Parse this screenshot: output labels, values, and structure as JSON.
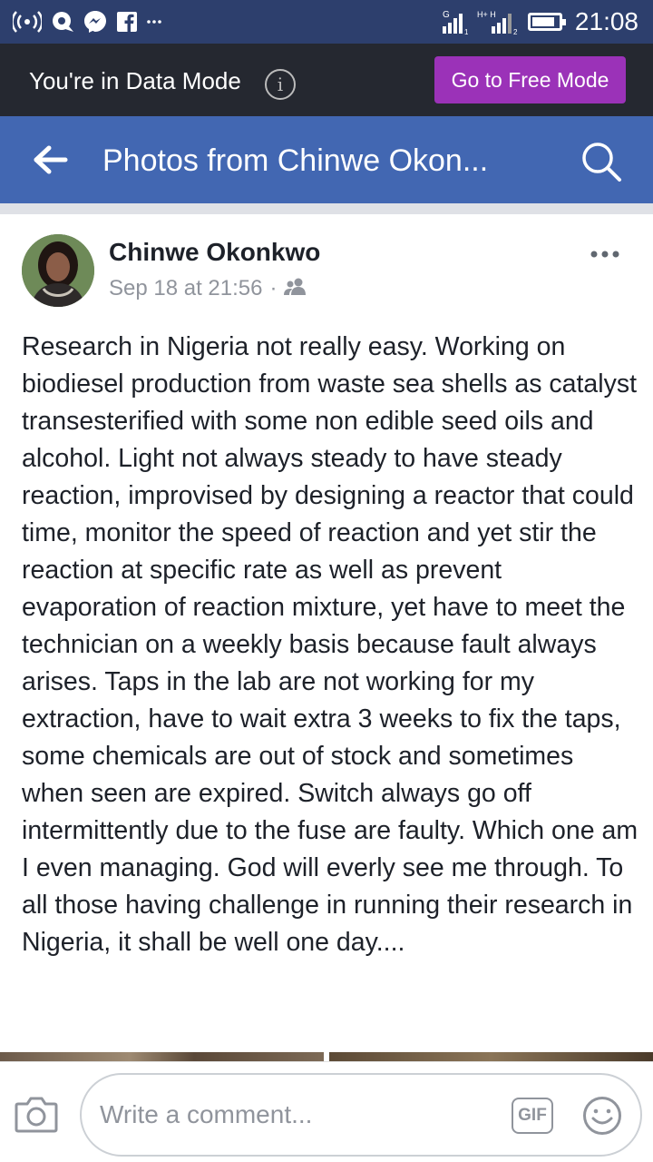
{
  "status_bar": {
    "time": "21:08",
    "network_label_1": "G",
    "network_label_2": "H+ H",
    "sim_1": "1",
    "sim_2": "2",
    "battery_level": 0.85,
    "icons": [
      "wifi-hotspot-icon",
      "chat-bubble-icon",
      "messenger-icon",
      "facebook-icon",
      "more-notifications-icon",
      "signal-icon",
      "battery-icon"
    ]
  },
  "data_mode_banner": {
    "text": "You're in Data Mode",
    "info_glyph": "i",
    "button_label": "Go to Free Mode",
    "button_color": "#9b32b8"
  },
  "header": {
    "title": "Photos from Chinwe Okon...",
    "bar_color": "#4267b2"
  },
  "post": {
    "author": "Chinwe Okonkwo",
    "timestamp": "Sep 18 at 21:56",
    "separator": "·",
    "audience_icon": "friends-icon",
    "body": "Research in Nigeria not really easy. Working on biodiesel production from waste sea shells as catalyst transesterified with some non edible seed oils and alcohol. Light not always steady to have steady reaction, improvised by designing a reactor that could time, monitor the speed of reaction and yet stir the reaction at specific rate as well as prevent evaporation of reaction mixture, yet have to meet the technician on a weekly basis because fault always arises. Taps in the lab are not working for my extraction, have to wait extra 3 weeks to fix the taps, some chemicals are out of stock and sometimes when seen are expired. Switch always go off intermittently due to the fuse are faulty. Which one am I even managing. God will everly see me through. To all those having challenge in running their research in Nigeria, it shall be well one day...."
  },
  "comment_bar": {
    "placeholder": "Write a comment...",
    "gif_label": "GIF"
  }
}
